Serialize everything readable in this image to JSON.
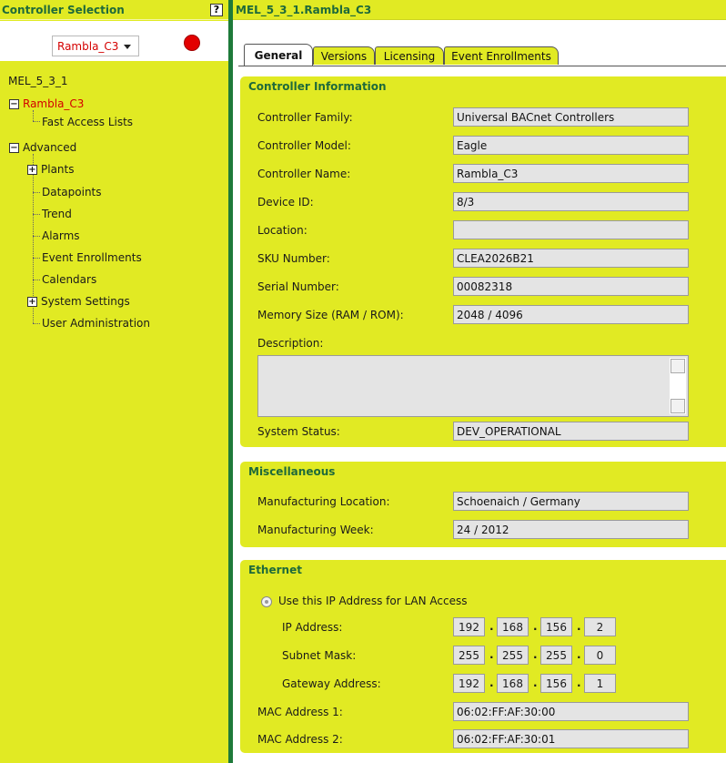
{
  "sidebar": {
    "title": "Controller Selection",
    "help_label": "?",
    "controller_selected": "Rambla_C3",
    "status_color": "#e30000",
    "tree": {
      "root": "MEL_5_3_1",
      "controller": "Rambla_C3",
      "fast_access": "Fast Access Lists",
      "advanced": "Advanced",
      "plants": "Plants",
      "datapoints": "Datapoints",
      "trend": "Trend",
      "alarms": "Alarms",
      "event_enrollments": "Event Enrollments",
      "calendars": "Calendars",
      "system_settings": "System Settings",
      "user_admin": "User Administration"
    }
  },
  "main": {
    "title": "MEL_5_3_1.Rambla_C3",
    "tabs": [
      "General",
      "Versions",
      "Licensing",
      "Event Enrollments"
    ],
    "active_tab": "General"
  },
  "controller_info": {
    "title": "Controller Information",
    "fields": [
      {
        "label": "Controller Family:",
        "value": "Universal BACnet Controllers"
      },
      {
        "label": "Controller Model:",
        "value": "Eagle"
      },
      {
        "label": "Controller Name:",
        "value": "Rambla_C3"
      },
      {
        "label": "Device ID:",
        "value": "8/3"
      },
      {
        "label": "Location:",
        "value": ""
      },
      {
        "label": "SKU Number:",
        "value": "CLEA2026B21"
      },
      {
        "label": "Serial Number:",
        "value": "00082318"
      },
      {
        "label": "Memory Size (RAM / ROM):",
        "value": "2048 / 4096"
      }
    ],
    "description_label": "Description:",
    "description_value": "",
    "system_status_label": "System Status:",
    "system_status_value": "DEV_OPERATIONAL"
  },
  "misc": {
    "title": "Miscellaneous",
    "fields": [
      {
        "label": "Manufacturing Location:",
        "value": "Schoenaich / Germany"
      },
      {
        "label": "Manufacturing Week:",
        "value": "24 / 2012"
      }
    ]
  },
  "ethernet": {
    "title": "Ethernet",
    "use_ip_label": "Use this IP Address for LAN Access",
    "ip_label": "IP Address:",
    "ip": [
      "192",
      "168",
      "156",
      "2"
    ],
    "subnet_label": "Subnet Mask:",
    "subnet": [
      "255",
      "255",
      "255",
      "0"
    ],
    "gateway_label": "Gateway Address:",
    "gateway": [
      "192",
      "168",
      "156",
      "1"
    ],
    "mac1_label": "MAC Address 1:",
    "mac1": "06:02:FF:AF:30:00",
    "mac2_label": "MAC Address 2:",
    "mac2": "06:02:FF:AF:30:01"
  }
}
